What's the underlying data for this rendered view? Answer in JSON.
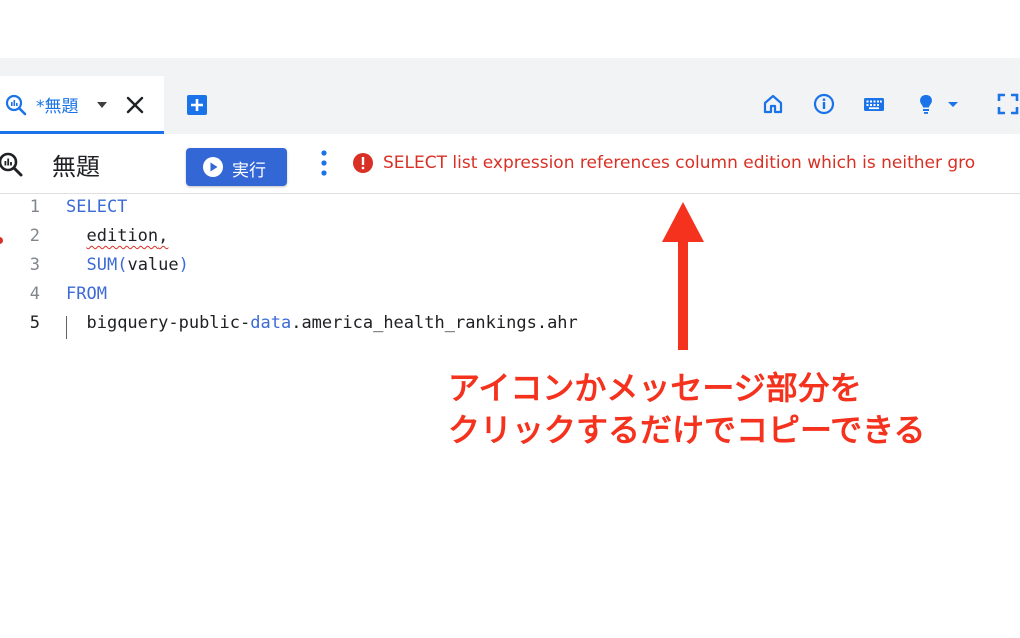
{
  "tab": {
    "label": "*無題"
  },
  "toolbar": {
    "query_title": "無題",
    "run_label": "実行",
    "error_message": "SELECT list expression references column edition which is neither gro"
  },
  "editor": {
    "lines": [
      {
        "number": "1",
        "text": "SELECT"
      },
      {
        "number": "2",
        "text": "edition,"
      },
      {
        "number": "3",
        "text": "SUM(value)"
      },
      {
        "number": "4",
        "text": "FROM"
      },
      {
        "number": "5",
        "text": "bigquery-public-data.america_health_rankings.ahr"
      }
    ],
    "tokens": {
      "l1_kw": "SELECT",
      "l2_ident": "edition",
      "l2_comma": ",",
      "l3_fn": "SUM",
      "l3_open": "(",
      "l3_ident": "value",
      "l3_close": ")",
      "l4_kw": "FROM",
      "l5_a": "bigquery-public-",
      "l5_kw": "data",
      "l5_b": ".america_health_rankings.ahr"
    }
  },
  "annotation": {
    "line1": "アイコンかメッセージ部分を",
    "line2": "クリックするだけでコピーできる"
  },
  "icons": [
    "query-tab-icon",
    "chevron-down-icon",
    "close-icon",
    "add-tab-icon",
    "home-icon",
    "info-icon",
    "keyboard-icon",
    "lightbulb-icon",
    "fullscreen-icon",
    "query-icon",
    "play-icon",
    "more-vert-icon",
    "error-icon",
    "arrow-up-icon"
  ],
  "colors": {
    "accent": "#1a73e8",
    "run_button": "#3367d6",
    "error": "#d93025",
    "annotation": "#f4321e"
  }
}
